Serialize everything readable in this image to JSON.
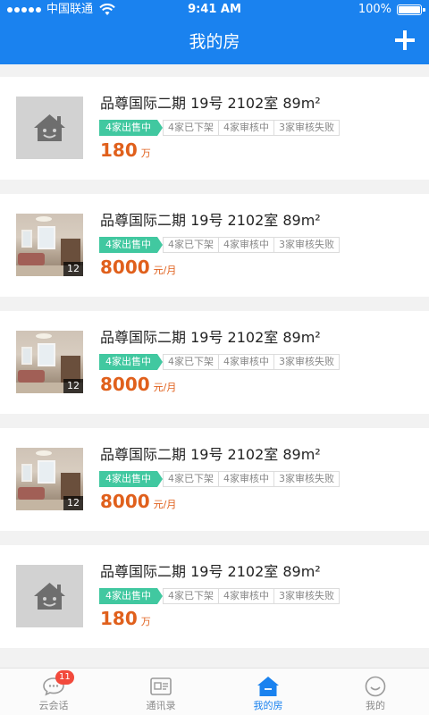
{
  "status_bar": {
    "carrier": "中国联通",
    "time": "9:41 AM",
    "battery": "100%"
  },
  "header": {
    "title": "我的房",
    "add_icon": "plus-icon"
  },
  "listings": [
    {
      "title": "品尊国际二期 19号 2102室 89m²",
      "image": "placeholder",
      "photo_count": "",
      "tags": [
        "4家出售中",
        "4家已下架",
        "4家审核中",
        "3家审核失败"
      ],
      "price": "180",
      "unit": "万"
    },
    {
      "title": "品尊国际二期 19号 2102室 89m²",
      "image": "photo",
      "photo_count": "12",
      "tags": [
        "4家出售中",
        "4家已下架",
        "4家审核中",
        "3家审核失败"
      ],
      "price": "8000",
      "unit": "元/月"
    },
    {
      "title": "品尊国际二期 19号 2102室 89m²",
      "image": "photo",
      "photo_count": "12",
      "tags": [
        "4家出售中",
        "4家已下架",
        "4家审核中",
        "3家审核失败"
      ],
      "price": "8000",
      "unit": "元/月"
    },
    {
      "title": "品尊国际二期 19号 2102室 89m²",
      "image": "photo",
      "photo_count": "12",
      "tags": [
        "4家出售中",
        "4家已下架",
        "4家审核中",
        "3家审核失败"
      ],
      "price": "8000",
      "unit": "元/月"
    },
    {
      "title": "品尊国际二期 19号 2102室 89m²",
      "image": "placeholder",
      "photo_count": "",
      "tags": [
        "4家出售中",
        "4家已下架",
        "4家审核中",
        "3家审核失败"
      ],
      "price": "180",
      "unit": "万"
    }
  ],
  "tabbar": {
    "items": [
      {
        "label": "云会话",
        "icon": "chat-bubble-icon",
        "badge": "11",
        "active": false
      },
      {
        "label": "通讯录",
        "icon": "contact-card-icon",
        "badge": "",
        "active": false
      },
      {
        "label": "我的房",
        "icon": "house-icon",
        "badge": "",
        "active": true
      },
      {
        "label": "我的",
        "icon": "smiley-icon",
        "badge": "",
        "active": false
      }
    ]
  },
  "colors": {
    "brand_blue": "#1a82ef",
    "tag_green": "#41c8a0",
    "price_orange": "#e0601c",
    "badge_red": "#f24a3c"
  }
}
